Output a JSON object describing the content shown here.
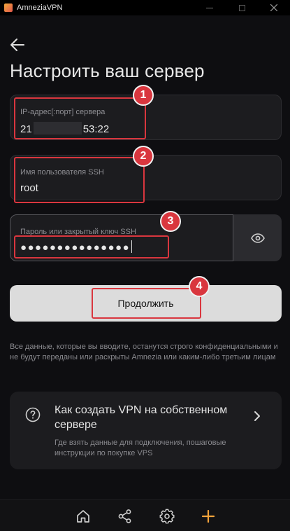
{
  "window": {
    "title": "AmneziaVPN"
  },
  "page": {
    "title": "Настроить ваш сервер"
  },
  "fields": {
    "ip": {
      "label": "IP-адрес[:порт] сервера",
      "value_prefix": "21",
      "value_suffix": "53:22"
    },
    "ssh_user": {
      "label": "Имя пользователя SSH",
      "value": "root"
    },
    "password": {
      "label": "Пароль или закрытый ключ SSH",
      "value": "●●●●●●●●●●●●●●●"
    }
  },
  "actions": {
    "continue_label": "Продолжить"
  },
  "note": "Все данные, которые вы вводите, останутся строго конфиденциальными и не будут переданы или раскрыты Amnezia или каким-либо третьим лицам",
  "help": {
    "title": "Как создать VPN на собственном сервере",
    "subtitle": "Где взять данные для подключения, пошаговые инструкции по покупке VPS"
  },
  "callouts": [
    "1",
    "2",
    "3",
    "4"
  ],
  "colors": {
    "accent_orange": "#f4a43b",
    "callout_red": "#d9363e"
  }
}
